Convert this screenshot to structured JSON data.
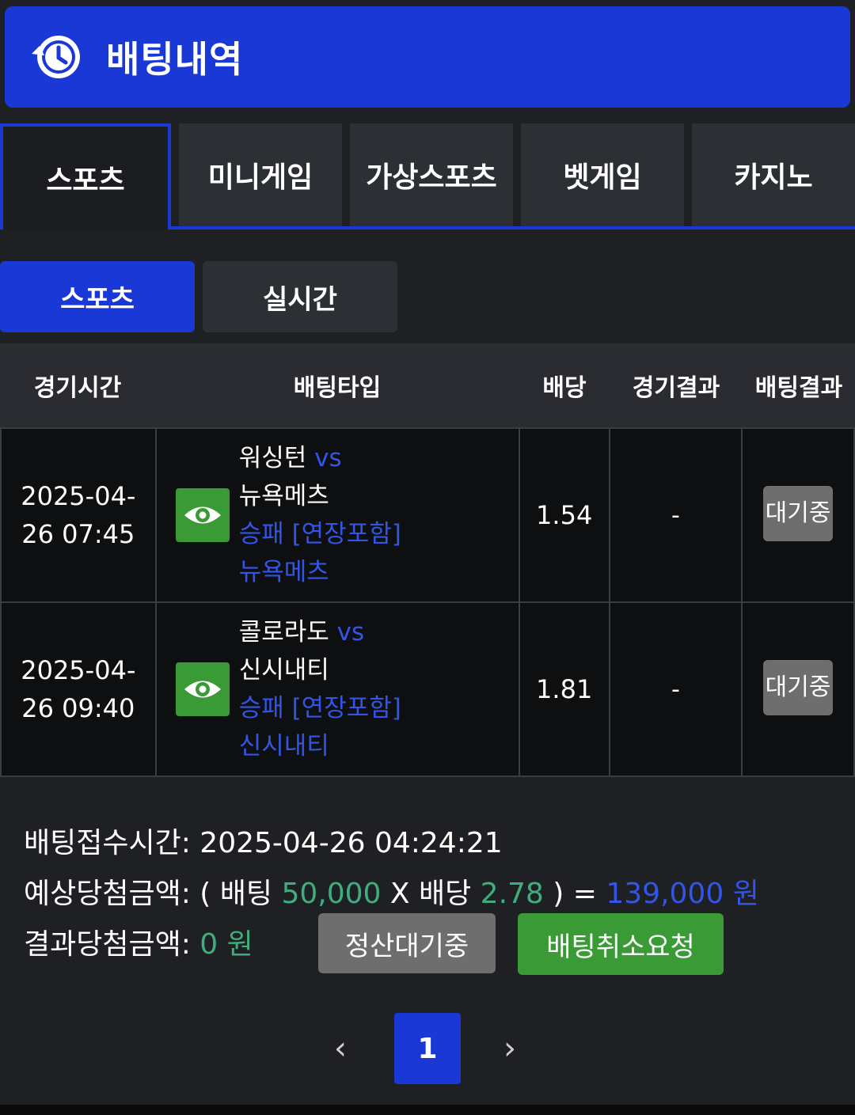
{
  "header": {
    "title": "배팅내역",
    "icon": "history-clock-icon"
  },
  "tabs": [
    {
      "label": "스포츠",
      "active": true
    },
    {
      "label": "미니게임",
      "active": false
    },
    {
      "label": "가상스포츠",
      "active": false
    },
    {
      "label": "벳게임",
      "active": false
    },
    {
      "label": "카지노",
      "active": false
    }
  ],
  "subtabs": [
    {
      "label": "스포츠",
      "active": true
    },
    {
      "label": "실시간",
      "active": false
    }
  ],
  "table": {
    "headers": [
      "경기시간",
      "배팅타입",
      "배당",
      "경기결과",
      "배팅결과"
    ],
    "rows": [
      {
        "time_date": "2025-04-",
        "time_rest": "26 07:45",
        "home": "워싱턴",
        "vs": "vs",
        "away": "뉴욕메츠",
        "market": "승패 [연장포함]",
        "pick": "뉴욕메츠",
        "odds": "1.54",
        "result": "-",
        "status": "대기중"
      },
      {
        "time_date": "2025-04-",
        "time_rest": "26 09:40",
        "home": "콜로라도",
        "vs": "vs",
        "away": "신시내티",
        "market": "승패 [연장포함]",
        "pick": "신시내티",
        "odds": "1.81",
        "result": "-",
        "status": "대기중"
      }
    ]
  },
  "summary": {
    "bet_time_label": "배팅접수시간: ",
    "bet_time": "2025-04-26 04:24:21",
    "expected_label": "예상당첨금액: ( 배팅 ",
    "stake": "50,000",
    "mult_label": " X 배당 ",
    "total_odds": "2.78",
    "eq_label": " ) = ",
    "expected_amount": "139,000 원",
    "result_label": "결과당첨금액: ",
    "result_amount": "0 원",
    "settle_button": "정산대기중",
    "cancel_button": "배팅취소요청"
  },
  "pagination": {
    "prev": "‹",
    "current": "1",
    "next": "›"
  },
  "colors": {
    "accent": "#1a38d6",
    "green": "#3a9a36",
    "link_blue": "#3355e6",
    "amount_green": "#3fae7c"
  }
}
